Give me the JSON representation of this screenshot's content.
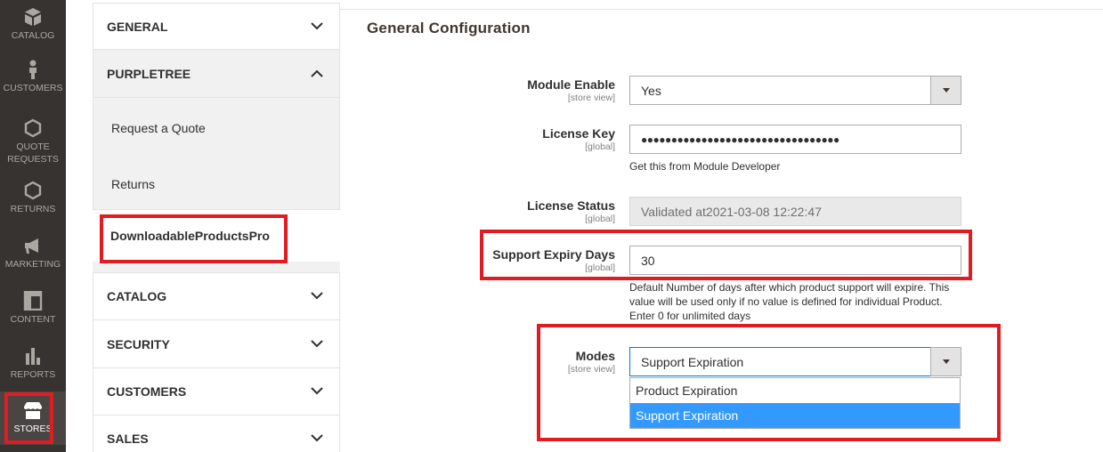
{
  "nav": {
    "items": [
      {
        "label": "CATALOG",
        "icon": "catalog-icon"
      },
      {
        "label": "CUSTOMERS",
        "icon": "customers-icon"
      },
      {
        "label": "QUOTE REQUESTS",
        "icon": "hexagon-icon"
      },
      {
        "label": "RETURNS",
        "icon": "hexagon-icon"
      },
      {
        "label": "MARKETING",
        "icon": "megaphone-icon"
      },
      {
        "label": "CONTENT",
        "icon": "content-icon"
      },
      {
        "label": "REPORTS",
        "icon": "bar-chart-icon"
      },
      {
        "label": "STORES",
        "icon": "store-icon"
      }
    ]
  },
  "tabs": {
    "general": "GENERAL",
    "purpletree": "PURPLETREE",
    "sub_items": [
      "Request a Quote",
      "Returns",
      "DownloadableProductsPro"
    ],
    "catalog": "CATALOG",
    "security": "SECURITY",
    "customers": "CUSTOMERS",
    "sales": "SALES"
  },
  "section": {
    "title": "General Configuration"
  },
  "fields": {
    "module_enable": {
      "label": "Module Enable",
      "scope": "[store view]",
      "value": "Yes"
    },
    "license_key": {
      "label": "License Key",
      "scope": "[global]",
      "value": "●●●●●●●●●●●●●●●●●●●●●●●●●●●●●●●●●",
      "note": "Get this from Module Developer"
    },
    "license_status": {
      "label": "License Status",
      "scope": "[global]",
      "value": "Validated at2021-03-08 12:22:47"
    },
    "support_expiry_days": {
      "label": "Support Expiry Days",
      "scope": "[global]",
      "value": "30",
      "note": "Default Number of days after which product support will expire. This value will be used only if no value is defined for individual Product. Enter 0 for unlimited days"
    },
    "modes": {
      "label": "Modes",
      "scope": "[store view]",
      "value": "Support Expiration",
      "options": [
        "Product Expiration",
        "Support Expiration"
      ],
      "selected_option": "Support Expiration"
    }
  },
  "colors": {
    "nav_bg": "#373330",
    "highlight_red": "#e21b22",
    "option_selected": "#3399ff"
  }
}
